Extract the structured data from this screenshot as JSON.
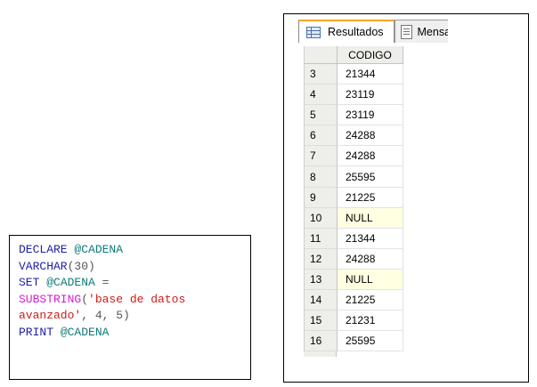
{
  "code": {
    "line1": {
      "kw": "DECLARE",
      "var": "@CADENA"
    },
    "line2": {
      "kw": "VARCHAR",
      "rest": "(30)"
    },
    "line3": {
      "kw": "SET",
      "var": "@CADENA",
      "rest": "="
    },
    "line4": {
      "fn": "SUBSTRING",
      "open": "(",
      "str": "'base de datos"
    },
    "line5": {
      "str": "avanzado'",
      "rest": ", 4, 5)"
    },
    "line6": {
      "kw": "PRINT",
      "var": "@CADENA"
    }
  },
  "results": {
    "tabs": [
      {
        "label": "Resultados",
        "icon": "grid-icon",
        "active": true
      },
      {
        "label": "Mensajes",
        "icon": "messages-icon",
        "active": false
      }
    ],
    "column_header": "CODIGO",
    "rows": [
      {
        "num": "3",
        "value": "21344",
        "null": false
      },
      {
        "num": "4",
        "value": "23119",
        "null": false
      },
      {
        "num": "5",
        "value": "23119",
        "null": false
      },
      {
        "num": "6",
        "value": "24288",
        "null": false
      },
      {
        "num": "7",
        "value": "24288",
        "null": false
      },
      {
        "num": "8",
        "value": "25595",
        "null": false
      },
      {
        "num": "9",
        "value": "21225",
        "null": false
      },
      {
        "num": "10",
        "value": "NULL",
        "null": true
      },
      {
        "num": "11",
        "value": "21344",
        "null": false
      },
      {
        "num": "12",
        "value": "24288",
        "null": false
      },
      {
        "num": "13",
        "value": "NULL",
        "null": true
      },
      {
        "num": "14",
        "value": "21225",
        "null": false
      },
      {
        "num": "15",
        "value": "21231",
        "null": false
      },
      {
        "num": "16",
        "value": "25595",
        "null": false
      }
    ]
  }
}
